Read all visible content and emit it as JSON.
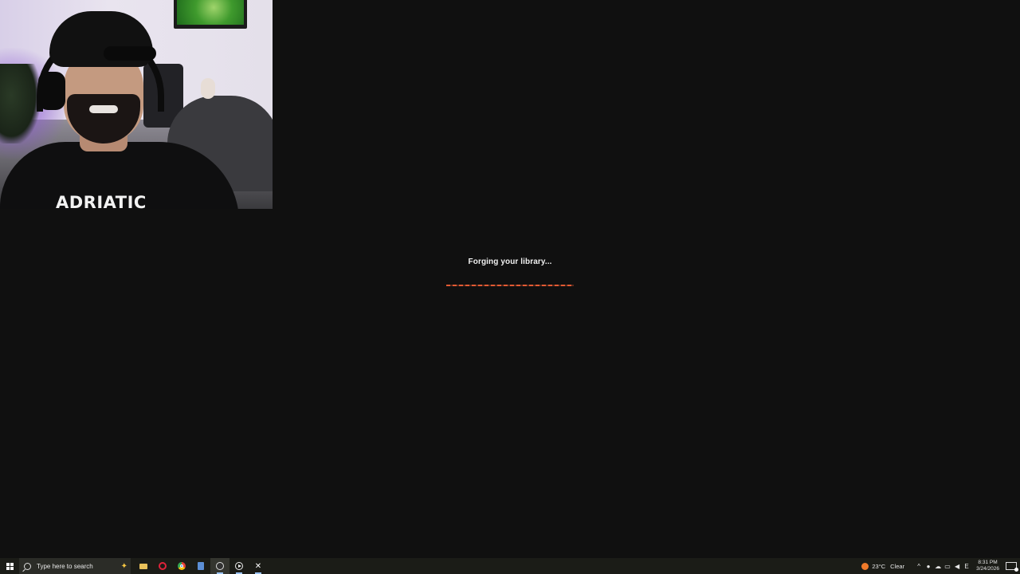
{
  "loader": {
    "title": "Forging your library...",
    "progress_fraction": 1.0,
    "accent_color": "#e25a33"
  },
  "webcam": {
    "shirt_text": "ADRIATIC"
  },
  "taskbar": {
    "search_placeholder": "Type here to search",
    "apps": [
      "file-explorer",
      "opera",
      "chrome",
      "calculator",
      "obs",
      "media-player",
      "x-app"
    ],
    "weather": {
      "temperature": "23°C",
      "condition": "Clear"
    },
    "language": "E",
    "clock": {
      "time": "8:31 PM",
      "date": "3/24/2026"
    }
  }
}
